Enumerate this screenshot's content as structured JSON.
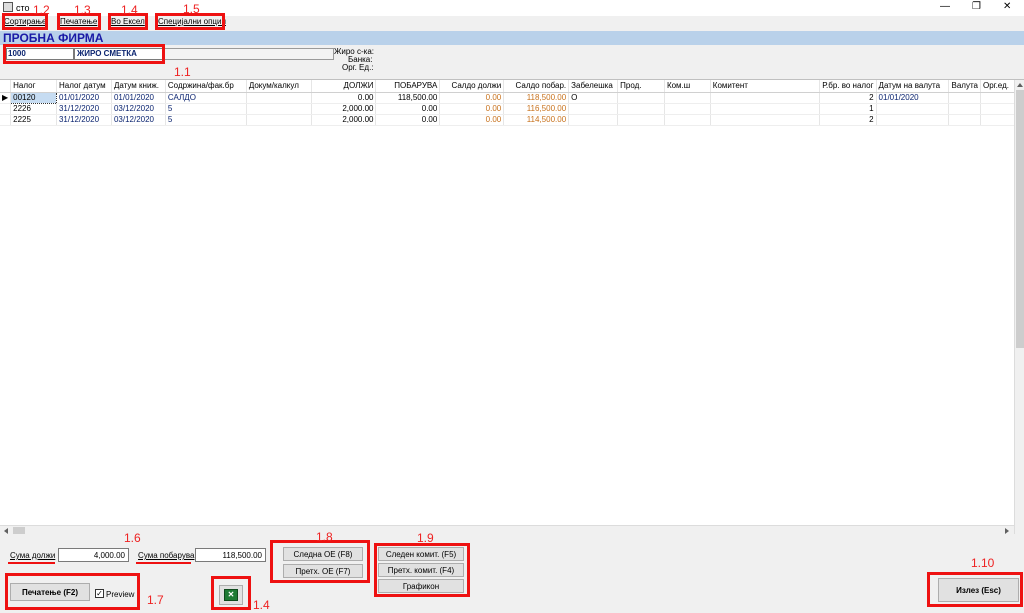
{
  "window": {
    "title": "сто",
    "controls": {
      "minimize": "—",
      "restore": "❐",
      "close": "✕"
    }
  },
  "menu": {
    "sort": "Сортирање",
    "print": "Печатење",
    "excel": "Во Ексел",
    "special": "Специјални опции"
  },
  "company": {
    "name": "ПРОБНА ФИРМА",
    "account_code": "1000",
    "account_name": "ЖИРО СМЕТКА",
    "giro_label": "Жиро с-ка:",
    "bank_label": "Банка:",
    "org_label": "Орг. Ед.:"
  },
  "table": {
    "columns": [
      "Налог",
      "Налог датум",
      "Датум книж.",
      "Содржина/фак.бр",
      "Докум/калкул",
      "ДОЛЖИ",
      "ПОБАРУВА",
      "Салдо должи",
      "Салдо побар.",
      "Забелешка",
      "Прод.",
      "Ком.ш",
      "Комитент",
      "Р.бр. во налог",
      "Датум на валута",
      "Валута",
      "Орг.ед."
    ],
    "rows": [
      {
        "marker": "▶",
        "cells": [
          "00120",
          "01/01/2020",
          "01/01/2020",
          "САЛДО",
          "",
          "0.00",
          "118,500.00",
          "0.00",
          "118,500.00",
          "О",
          "",
          "",
          "",
          "2",
          "01/01/2020",
          "",
          ""
        ]
      },
      {
        "marker": "",
        "cells": [
          "2226",
          "31/12/2020",
          "03/12/2020",
          "5",
          "",
          "2,000.00",
          "0.00",
          "0.00",
          "116,500.00",
          "",
          "",
          "",
          "",
          "1",
          "",
          "",
          ""
        ]
      },
      {
        "marker": "",
        "cells": [
          "2225",
          "31/12/2020",
          "03/12/2020",
          "5",
          "",
          "2,000.00",
          "0.00",
          "0.00",
          "114,500.00",
          "",
          "",
          "",
          "",
          "2",
          "",
          "",
          ""
        ]
      }
    ]
  },
  "footer": {
    "sum_debit_label": "Сума должи",
    "sum_debit_value": "4,000.00",
    "sum_credit_label": "Сума побарува",
    "sum_credit_value": "118,500.00",
    "next_oe": "Следна ОЕ (F8)",
    "prev_oe": "Претх. ОЕ (F7)",
    "next_client": "Следен комит. (F5)",
    "prev_client": "Претх. комит. (F4)",
    "chart": "Графикон",
    "print_button": "Печатење (F2)",
    "preview_label": "Preview",
    "preview_checked": true,
    "exit_button": "Излез (Esc)"
  },
  "annotations": {
    "a1_1": "1.1",
    "a1_2": "1.2",
    "a1_3": "1.3",
    "a1_4": "1.4",
    "a1_5": "1.5",
    "a1_6": "1.6",
    "a1_7": "1.7",
    "a1_8": "1.8",
    "a1_9": "1.9",
    "a1_10": "1.10",
    "a1_4b": "1.4"
  },
  "colors": {
    "heading_blue": "#1a1aa6",
    "band_blue": "#b9d1ea",
    "annotation_red": "#ee1111",
    "saldo_orange": "#c8721d",
    "excel_green": "#1e7b34"
  }
}
